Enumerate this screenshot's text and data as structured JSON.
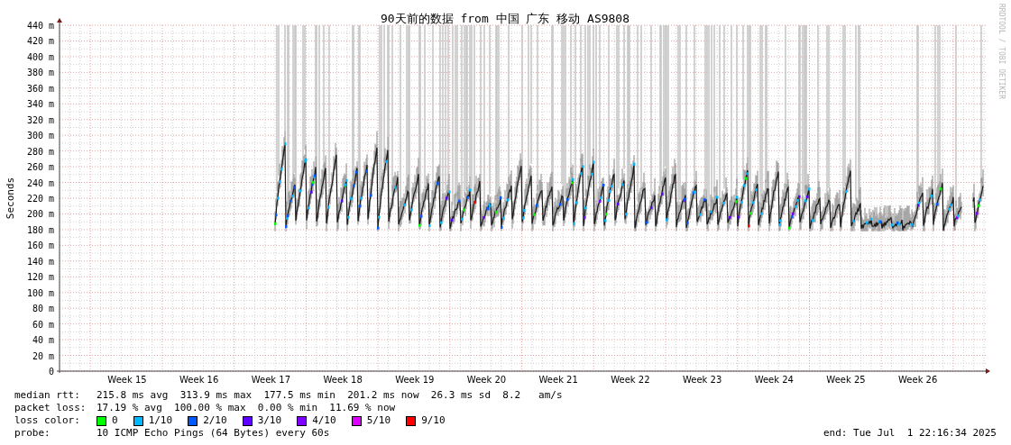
{
  "title": "90天前的数据 from 中国 广东 移动 AS9808",
  "y_axis_label": "Seconds",
  "y_ticks": [
    "440 m",
    "420 m",
    "400 m",
    "380 m",
    "360 m",
    "340 m",
    "320 m",
    "300 m",
    "280 m",
    "260 m",
    "240 m",
    "220 m",
    "200 m",
    "180 m",
    "160 m",
    "140 m",
    "120 m",
    "100 m",
    "80 m",
    "60 m",
    "40 m",
    "20 m",
    "0"
  ],
  "x_labels": [
    "Week 15",
    "Week 16",
    "Week 17",
    "Week 18",
    "Week 19",
    "Week 20",
    "Week 21",
    "Week 22",
    "Week 23",
    "Week 24",
    "Week 25",
    "Week 26"
  ],
  "credit": "RRDTOOL / TOBI OETIKER",
  "stats": [
    {
      "label": "median rtt:",
      "text": "215.8 ms avg  313.9 ms max  177.5 ms min  201.2 ms now  26.3 ms sd  8.2   am/s"
    },
    {
      "label": "packet loss:",
      "text": "17.19 % avg  100.00 % max  0.00 % min  11.69 % now"
    }
  ],
  "loss_color_label": "loss color:",
  "loss_colors": [
    {
      "label": "0",
      "color": "#00ff00"
    },
    {
      "label": "1/10",
      "color": "#00b8ff"
    },
    {
      "label": "2/10",
      "color": "#0059ff"
    },
    {
      "label": "3/10",
      "color": "#5e00ff"
    },
    {
      "label": "4/10",
      "color": "#7e00ff"
    },
    {
      "label": "5/10",
      "color": "#dd00ff"
    },
    {
      "label": "9/10",
      "color": "#ff0000"
    }
  ],
  "probe": {
    "label": "probe:",
    "text": "10 ICMP Echo Pings (64 Bytes) every 60s"
  },
  "end": "end: Tue Jul  1 22:16:34 2025"
}
